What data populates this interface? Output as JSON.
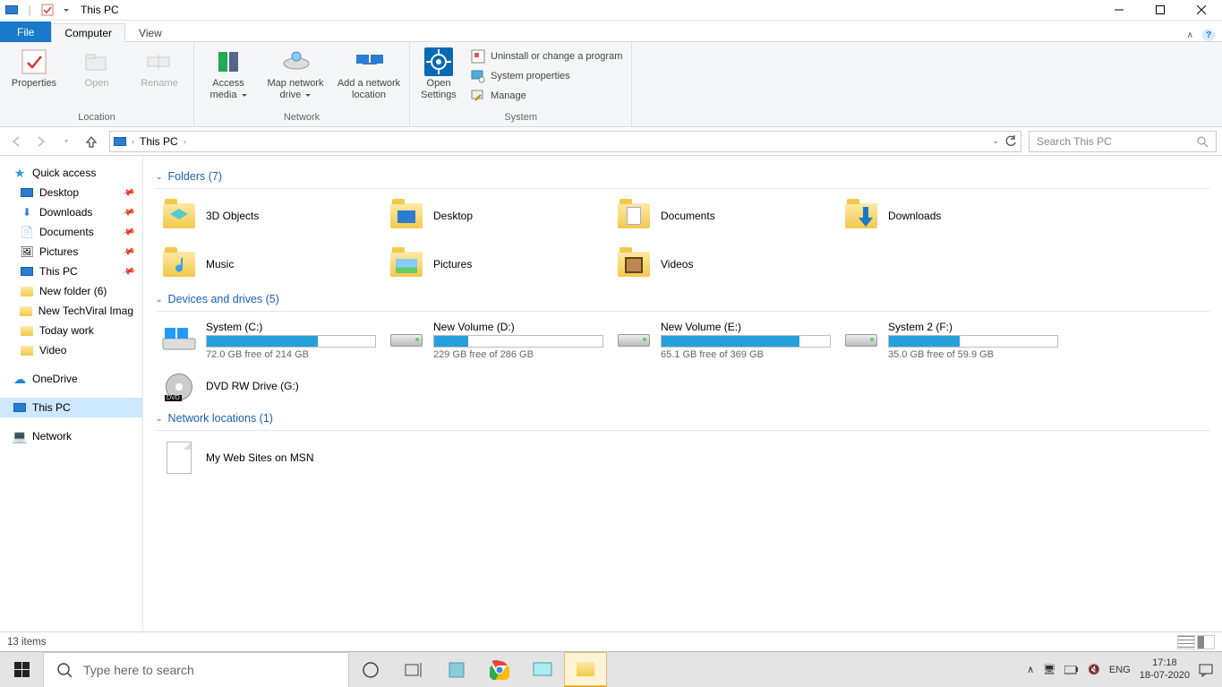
{
  "window": {
    "title": "This PC",
    "min": "—",
    "max": "☐",
    "close": "✕"
  },
  "tabs": {
    "file": "File",
    "computer": "Computer",
    "view": "View"
  },
  "ribbon": {
    "location": {
      "properties": "Properties",
      "open": "Open",
      "rename": "Rename",
      "group": "Location"
    },
    "network": {
      "access": "Access media",
      "map": "Map network drive",
      "add": "Add a network location",
      "group": "Network"
    },
    "system": {
      "open_settings": "Open Settings",
      "uninstall": "Uninstall or change a program",
      "props": "System properties",
      "manage": "Manage",
      "group": "System"
    }
  },
  "address": {
    "root": "This PC",
    "search_placeholder": "Search This PC"
  },
  "sidebar": {
    "quick": "Quick access",
    "desktop": "Desktop",
    "downloads": "Downloads",
    "documents": "Documents",
    "pictures": "Pictures",
    "thispc": "This PC",
    "newfolder": "New folder (6)",
    "techviral": "New TechViral Imag",
    "today": "Today work",
    "video": "Video",
    "onedrive": "OneDrive",
    "thispc2": "This PC",
    "network": "Network"
  },
  "sections": {
    "folders": "Folders (7)",
    "drives": "Devices and drives (5)",
    "netloc": "Network locations (1)"
  },
  "folders": {
    "f0": "3D Objects",
    "f1": "Desktop",
    "f2": "Documents",
    "f3": "Downloads",
    "f4": "Music",
    "f5": "Pictures",
    "f6": "Videos"
  },
  "drives": {
    "d0": {
      "name": "System (C:)",
      "free": "72.0 GB free of 214 GB",
      "pct": 66
    },
    "d1": {
      "name": "New Volume (D:)",
      "free": "229 GB free of 286 GB",
      "pct": 20
    },
    "d2": {
      "name": "New Volume (E:)",
      "free": "65.1 GB free of 369 GB",
      "pct": 82
    },
    "d3": {
      "name": "System 2 (F:)",
      "free": "35.0 GB free of 59.9 GB",
      "pct": 42
    },
    "d4": {
      "name": "DVD RW Drive (G:)"
    }
  },
  "netloc": {
    "n0": "My Web Sites on MSN"
  },
  "status": {
    "items": "13 items"
  },
  "taskbar": {
    "search": "Type here to search",
    "lang": "ENG",
    "time": "17:18",
    "date": "18-07-2020"
  }
}
